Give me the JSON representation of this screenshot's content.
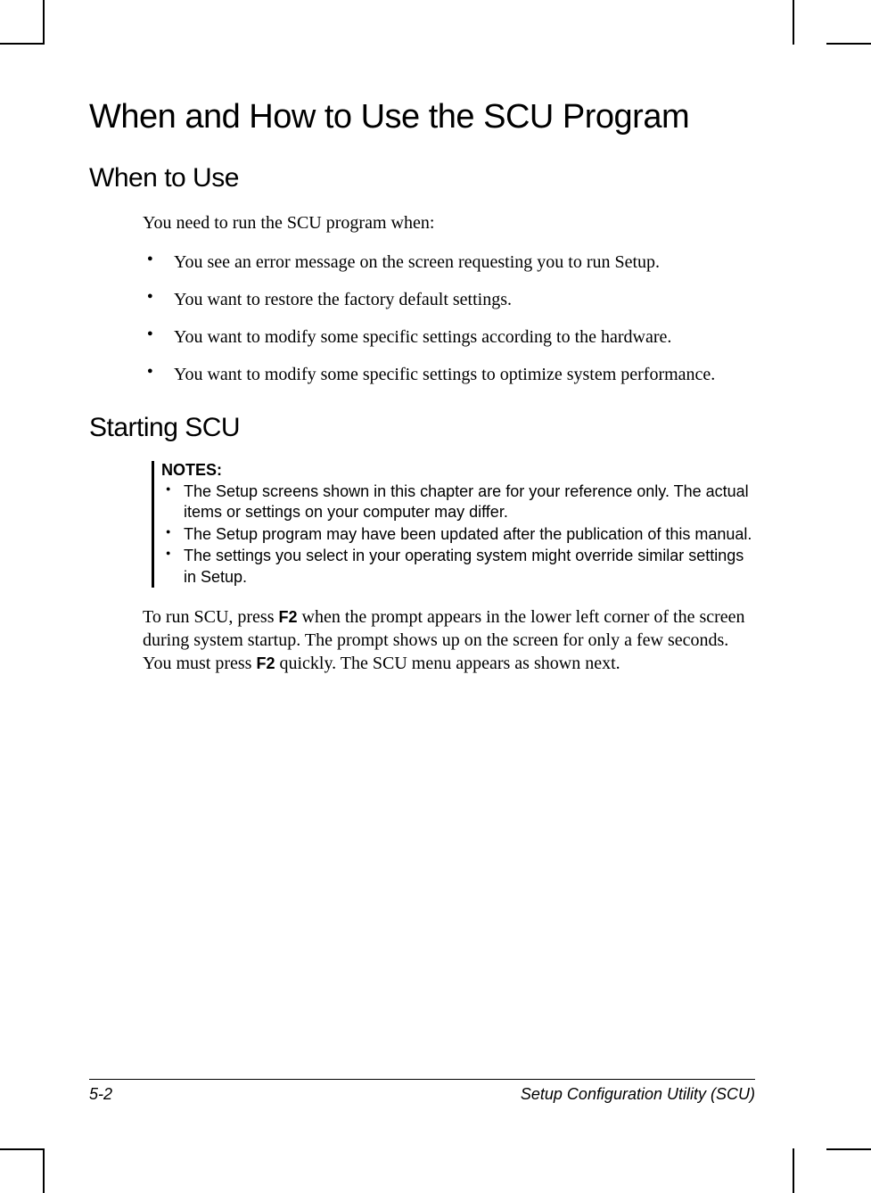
{
  "title": "When and How to Use the SCU Program",
  "section1": {
    "heading": "When to Use",
    "intro": "You need to run the SCU program when:",
    "items": [
      "You see an error message on the screen requesting you to run Setup.",
      "You want to restore the factory default settings.",
      "You want to modify some specific settings according to the hardware.",
      "You want to modify some specific settings to optimize system performance."
    ]
  },
  "section2": {
    "heading": "Starting SCU",
    "notes_label": "NOTES:",
    "notes": [
      "The Setup screens shown in this chapter are for your reference only. The actual items or settings on your computer may differ.",
      "The Setup program may have been updated after the publication of this manual.",
      "The settings you select in your operating system might override similar settings in Setup."
    ],
    "run_pre1": "To run SCU, press ",
    "key1": "F2",
    "run_mid": " when the prompt appears in the lower left corner of the screen during system startup. The prompt shows up on the screen for only a few seconds. You must press ",
    "key2": "F2",
    "run_post": " quickly. The SCU menu appears as shown next."
  },
  "footer": {
    "page": "5-2",
    "title": "Setup Configuration Utility (SCU)"
  }
}
